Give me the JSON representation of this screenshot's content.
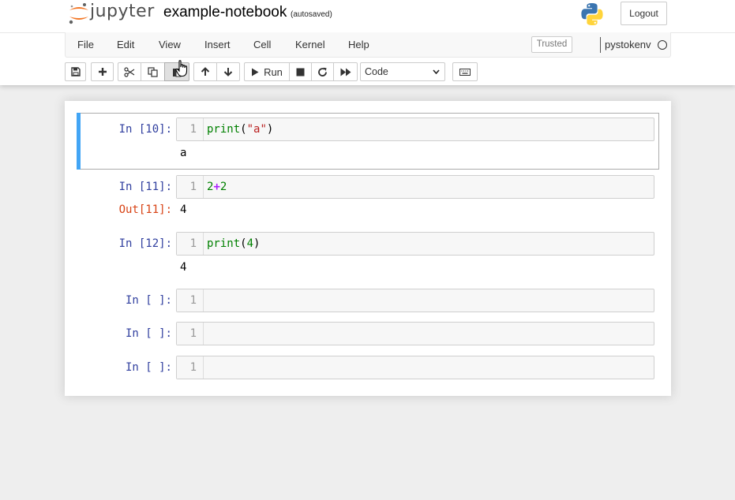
{
  "header": {
    "logo_text": "jupyter",
    "notebook_title": "example-notebook",
    "autosave_status": "(autosaved)",
    "logout_label": "Logout"
  },
  "menubar": {
    "items": [
      "File",
      "Edit",
      "View",
      "Insert",
      "Cell",
      "Kernel",
      "Help"
    ],
    "trusted_label": "Trusted",
    "kernel_name": "pystokenv"
  },
  "toolbar": {
    "run_label": "Run",
    "cell_type": "Code",
    "icons": [
      "save-icon",
      "plus-icon",
      "cut-icon",
      "copy-icon",
      "paste-icon",
      "arrow-up-icon",
      "arrow-down-icon",
      "play-icon",
      "stop-icon",
      "restart-icon",
      "fast-forward-icon",
      "keyboard-icon"
    ]
  },
  "cells": [
    {
      "prompt": "In [10]:",
      "line_number": "1",
      "code": {
        "fn": "print",
        "open": "(",
        "arg": "\"a\"",
        "close": ")"
      },
      "output": "a",
      "selected": true
    },
    {
      "prompt": "In [11]:",
      "line_number": "1",
      "code": {
        "a": "2",
        "op": "+",
        "b": "2"
      },
      "out_prompt": "Out[11]:",
      "output": "4"
    },
    {
      "prompt": "In [12]:",
      "line_number": "1",
      "code": {
        "fn": "print",
        "open": "(",
        "arg": "4",
        "close": ")"
      },
      "output": "4"
    },
    {
      "prompt": "In [ ]:",
      "line_number": "1"
    },
    {
      "prompt": "In [ ]:",
      "line_number": "1"
    },
    {
      "prompt": "In [ ]:",
      "line_number": "1"
    }
  ],
  "colors": {
    "selected_bar": "#42a5f5",
    "prompt_in": "#303f9f",
    "prompt_out": "#d84315",
    "jupyter_orange": "#f37726"
  }
}
